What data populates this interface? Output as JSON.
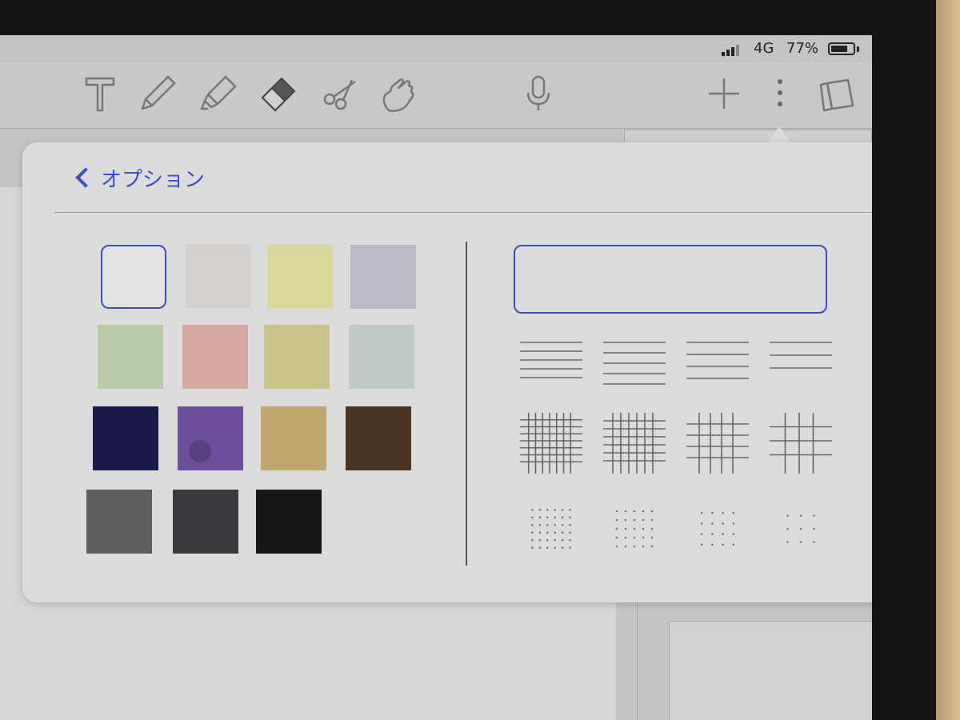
{
  "status_bar": {
    "network": "4G",
    "battery_percent_text": "77%",
    "battery_level": 0.77,
    "signal_bars": 4
  },
  "toolbar": {
    "tools": [
      {
        "name": "text-tool",
        "icon": "text-t-icon"
      },
      {
        "name": "pen-tool",
        "icon": "pen-icon"
      },
      {
        "name": "highlighter-tool",
        "icon": "highlighter-icon"
      },
      {
        "name": "eraser-tool",
        "icon": "eraser-icon"
      },
      {
        "name": "lasso-tool",
        "icon": "scissors-icon"
      },
      {
        "name": "hand-tool",
        "icon": "pointing-hand-icon"
      },
      {
        "name": "microphone",
        "icon": "microphone-icon"
      },
      {
        "name": "add-page",
        "icon": "plus-icon"
      },
      {
        "name": "more-options",
        "icon": "vertical-ellipsis-icon"
      },
      {
        "name": "page-overview",
        "icon": "pages-icon"
      }
    ]
  },
  "popover": {
    "back_label": "オプション",
    "colors": [
      {
        "name": "white",
        "hex": "#e2e2e2",
        "selected": true
      },
      {
        "name": "light-grey",
        "hex": "#d4d1cf"
      },
      {
        "name": "pale-yellow",
        "hex": "#dcd79e"
      },
      {
        "name": "lavender-grey",
        "hex": "#b9bac6"
      },
      {
        "name": "pale-green",
        "hex": "#b9ccaa"
      },
      {
        "name": "pink",
        "hex": "#d8a8a2"
      },
      {
        "name": "olive-beige",
        "hex": "#c9c28a"
      },
      {
        "name": "mint-grey",
        "hex": "#c0cac4"
      },
      {
        "name": "navy",
        "hex": "#1b1a4a"
      },
      {
        "name": "purple",
        "hex": "#6c4f9a"
      },
      {
        "name": "kraft",
        "hex": "#c2a56e"
      },
      {
        "name": "dark-brown",
        "hex": "#4a3421"
      },
      {
        "name": "grey",
        "hex": "#5e5e60"
      },
      {
        "name": "charcoal",
        "hex": "#3a3b3e"
      },
      {
        "name": "black",
        "hex": "#17171a"
      }
    ],
    "paper_styles": {
      "blank": {
        "name": "blank",
        "selected": true
      },
      "lined": [
        "lined-narrow",
        "lined-medium",
        "lined-wide",
        "lined-extra-wide"
      ],
      "grid": [
        "grid-small",
        "grid-medium",
        "grid-large",
        "grid-extra-large"
      ],
      "dotted": [
        "dots-small",
        "dots-medium",
        "dots-large",
        "dots-extra-large"
      ]
    },
    "accent_color": "#3a4fc2"
  }
}
